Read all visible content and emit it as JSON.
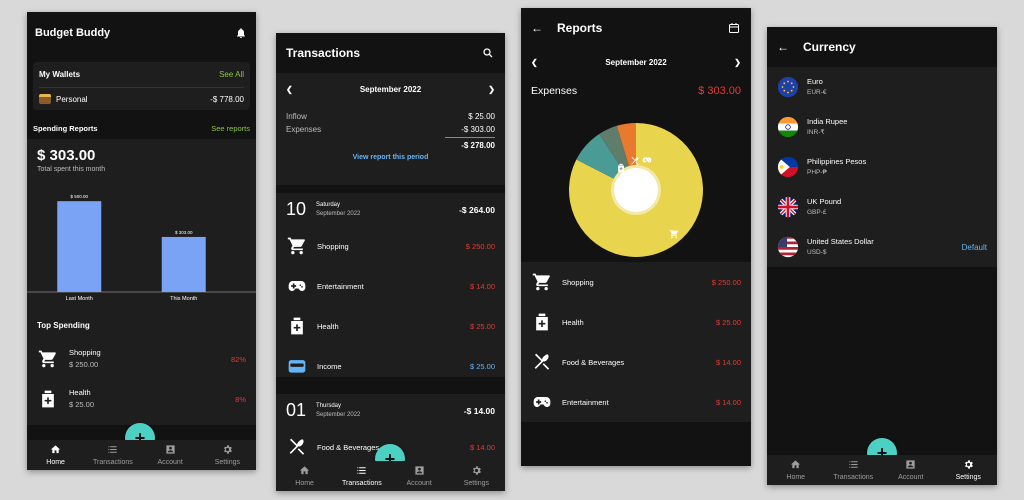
{
  "screen1": {
    "app_title": "Budget Buddy",
    "wallets_title": "My Wallets",
    "see_all": "See All",
    "wallet_name": "Personal",
    "wallet_amount": "-$ 778.00",
    "spending_reports": "Spending Reports",
    "see_reports": "See reports",
    "total": "$ 303.00",
    "total_sub": "Total spent this month",
    "top_spending": "Top Spending",
    "top": [
      {
        "name": "Shopping",
        "amount": "$ 250.00",
        "pct": "82%"
      },
      {
        "name": "Health",
        "amount": "$ 25.00",
        "pct": "8%"
      }
    ],
    "nav": [
      "Home",
      "Transactions",
      "Account",
      "Settings"
    ]
  },
  "chart_data": {
    "type": "bar",
    "categories": [
      "Last Month",
      "This Month"
    ],
    "values": [
      500,
      303
    ],
    "data_labels": [
      "$ 500.00",
      "$ 303.00"
    ],
    "ylim": [
      0,
      600
    ]
  },
  "screen2": {
    "title": "Transactions",
    "month": "September 2022",
    "inflow_label": "Inflow",
    "inflow": "$ 25.00",
    "expenses_label": "Expenses",
    "expenses": "-$ 303.00",
    "net": "-$ 278.00",
    "view_report": "View report this period",
    "group1": {
      "day": "10",
      "weekday": "Saturday",
      "monthyear": "September 2022",
      "total": "-$ 264.00"
    },
    "group1_items": [
      {
        "name": "Shopping",
        "amount": "$ 250.00",
        "icon": "cart-icon",
        "kind": "expense"
      },
      {
        "name": "Entertainment",
        "amount": "$ 14.00",
        "icon": "gamepad-icon",
        "kind": "expense"
      },
      {
        "name": "Health",
        "amount": "$ 25.00",
        "icon": "medkit-icon",
        "kind": "expense"
      },
      {
        "name": "Income",
        "amount": "$ 25.00",
        "icon": "wallet-icon",
        "kind": "income"
      }
    ],
    "group2": {
      "day": "01",
      "weekday": "Thursday",
      "monthyear": "September 2022",
      "total": "-$ 14.00"
    },
    "group2_items": [
      {
        "name": "Food & Beverages",
        "amount": "$ 14.00",
        "icon": "utensils-icon",
        "kind": "expense"
      }
    ],
    "nav": [
      "Home",
      "Transactions",
      "Account",
      "Settings"
    ]
  },
  "screen3": {
    "title": "Reports",
    "month": "September 2022",
    "expenses_label": "Expenses",
    "expenses_total": "$ 303.00",
    "pie": [
      {
        "name": "Shopping",
        "value": 250,
        "color": "#e8d44d"
      },
      {
        "name": "Health",
        "value": 25,
        "color": "#4a9a95"
      },
      {
        "name": "Food & Beverages",
        "value": 14,
        "color": "#5e7d6a"
      },
      {
        "name": "Entertainment",
        "value": 14,
        "color": "#e87a30"
      }
    ],
    "items": [
      {
        "name": "Shopping",
        "amount": "$ 250.00",
        "icon": "cart-icon"
      },
      {
        "name": "Health",
        "amount": "$ 25.00",
        "icon": "medkit-icon"
      },
      {
        "name": "Food & Beverages",
        "amount": "$ 14.00",
        "icon": "utensils-icon"
      },
      {
        "name": "Entertainment",
        "amount": "$ 14.00",
        "icon": "gamepad-icon"
      }
    ]
  },
  "screen4": {
    "title": "Currency",
    "currencies": [
      {
        "name": "Euro",
        "code": "EUR-€",
        "flag": "eu-flag-icon",
        "default": ""
      },
      {
        "name": "India Rupee",
        "code": "INR-₹",
        "flag": "india-flag-icon",
        "default": ""
      },
      {
        "name": "Philippines Pesos",
        "code": "PHP-₱",
        "flag": "philippines-flag-icon",
        "default": ""
      },
      {
        "name": "UK Pound",
        "code": "GBP-£",
        "flag": "uk-flag-icon",
        "default": ""
      },
      {
        "name": "United States Dollar",
        "code": "USD-$",
        "flag": "us-flag-icon",
        "default": "Default"
      }
    ],
    "nav": [
      "Home",
      "Transactions",
      "Account",
      "Settings"
    ]
  },
  "colors": {
    "accent": "#4dd0c4",
    "bar": "#7ba3f5",
    "expense": "#e53935",
    "income": "#64b5f6",
    "link": "#8bc34a"
  }
}
